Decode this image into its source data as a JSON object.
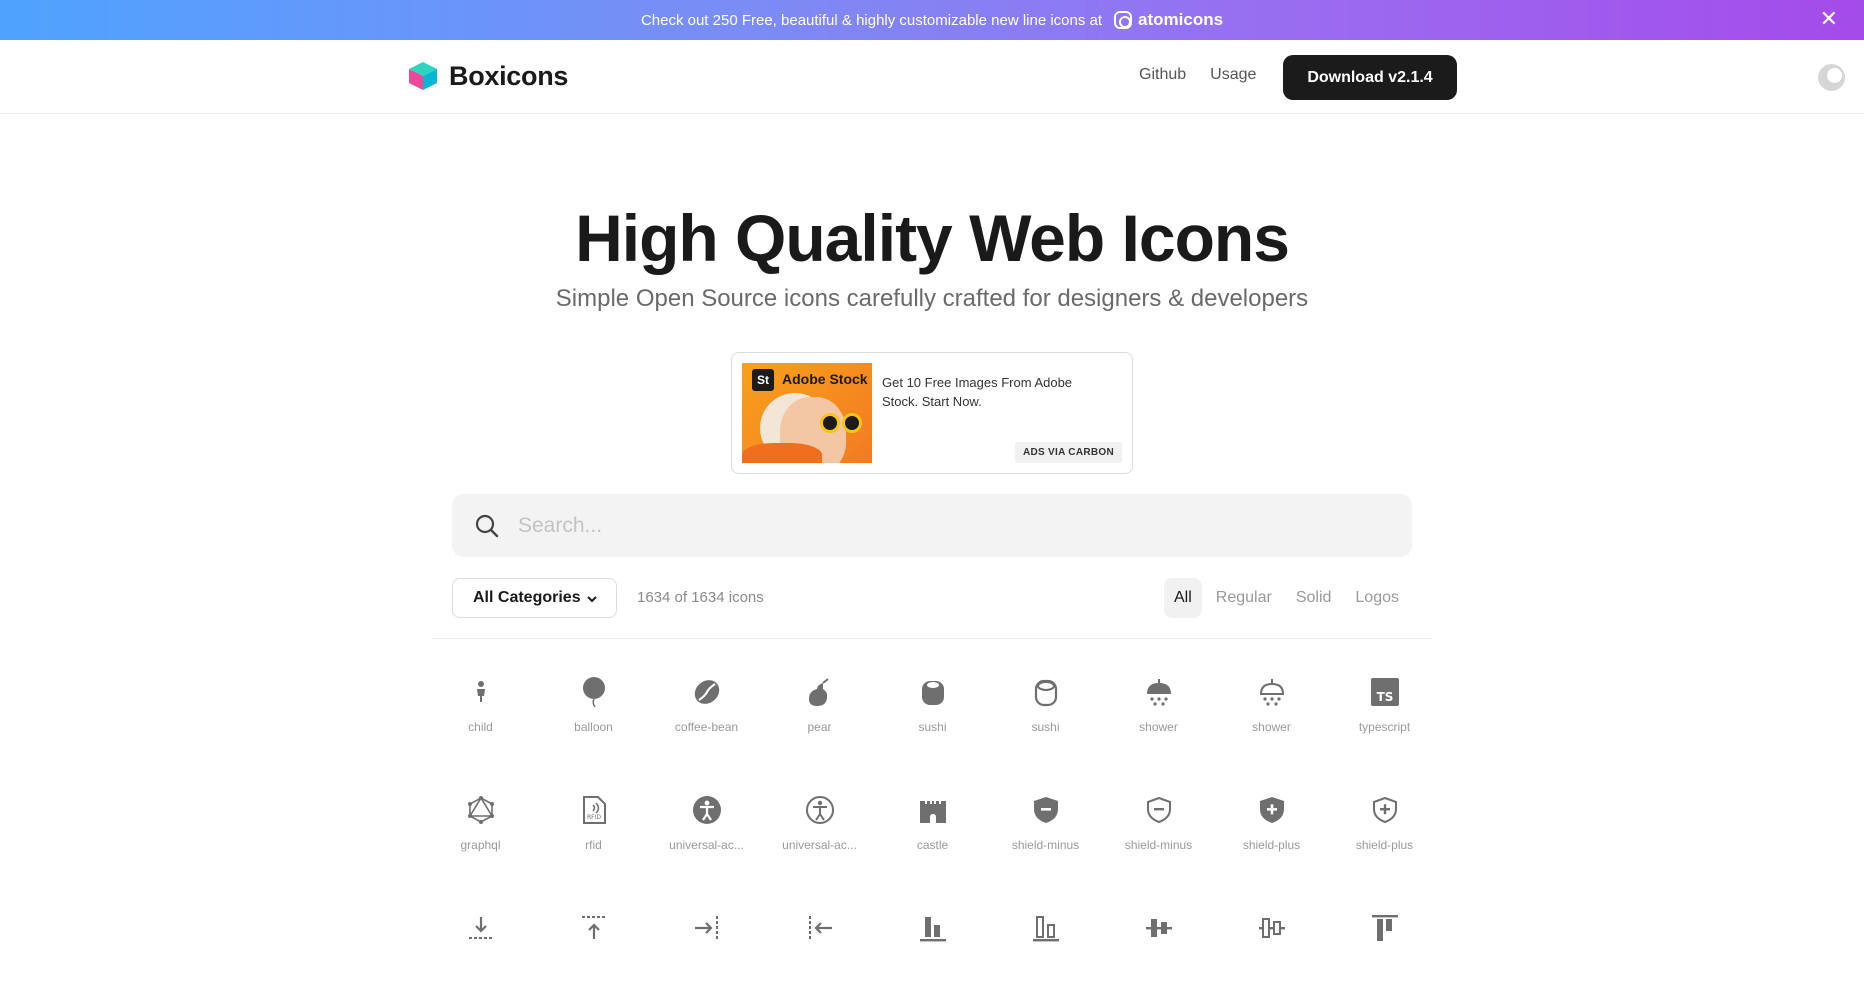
{
  "promo": {
    "text": "Check out 250 Free, beautiful & highly customizable new line icons at",
    "brand": "atomicons",
    "close": "✕"
  },
  "nav": {
    "logo_text": "Boxicons",
    "links": [
      "Github",
      "Usage"
    ],
    "download_label": "Download v2.1.4"
  },
  "hero": {
    "title": "High Quality Web Icons",
    "subtitle": "Simple Open Source icons carefully crafted for designers & developers"
  },
  "ad": {
    "badge": "St",
    "brand": "Adobe Stock",
    "text": "Get 10 Free Images From Adobe Stock. Start Now.",
    "via": "ADS VIA CARBON"
  },
  "search": {
    "placeholder": "Search..."
  },
  "filters": {
    "category": "All Categories",
    "count": "1634 of 1634 icons",
    "tabs": [
      "All",
      "Regular",
      "Solid",
      "Logos"
    ],
    "active_tab": "All"
  },
  "icons": [
    {
      "label": "child",
      "icon": "child-icon"
    },
    {
      "label": "balloon",
      "icon": "balloon-icon"
    },
    {
      "label": "coffee-bean",
      "icon": "coffee-bean-icon"
    },
    {
      "label": "pear",
      "icon": "pear-icon"
    },
    {
      "label": "sushi",
      "icon": "sushi-solid-icon"
    },
    {
      "label": "sushi",
      "icon": "sushi-regular-icon"
    },
    {
      "label": "shower",
      "icon": "shower-solid-icon"
    },
    {
      "label": "shower",
      "icon": "shower-regular-icon"
    },
    {
      "label": "typescript",
      "icon": "typescript-icon"
    },
    {
      "label": "graphql",
      "icon": "graphql-icon"
    },
    {
      "label": "rfid",
      "icon": "rfid-icon"
    },
    {
      "label": "universal-ac...",
      "icon": "universal-access-solid-icon"
    },
    {
      "label": "universal-ac...",
      "icon": "universal-access-regular-icon"
    },
    {
      "label": "castle",
      "icon": "castle-icon"
    },
    {
      "label": "shield-minus",
      "icon": "shield-minus-solid-icon"
    },
    {
      "label": "shield-minus",
      "icon": "shield-minus-regular-icon"
    },
    {
      "label": "shield-plus",
      "icon": "shield-plus-solid-icon"
    },
    {
      "label": "shield-plus",
      "icon": "shield-plus-regular-icon"
    },
    {
      "label": "",
      "icon": "vertical-bottom-icon"
    },
    {
      "label": "",
      "icon": "vertical-top-icon"
    },
    {
      "label": "",
      "icon": "horizontal-right-icon"
    },
    {
      "label": "",
      "icon": "horizontal-left-icon"
    },
    {
      "label": "",
      "icon": "align-bottom-solid-icon"
    },
    {
      "label": "",
      "icon": "align-bottom-regular-icon"
    },
    {
      "label": "",
      "icon": "align-middle-solid-icon"
    },
    {
      "label": "",
      "icon": "align-middle-regular-icon"
    },
    {
      "label": "",
      "icon": "align-top-icon"
    }
  ],
  "colors": {
    "icon": "#6f6f6f",
    "accent_dark": "#1b1b1b",
    "logo_teal": "#2dd4bf",
    "logo_pink": "#ec4899"
  }
}
